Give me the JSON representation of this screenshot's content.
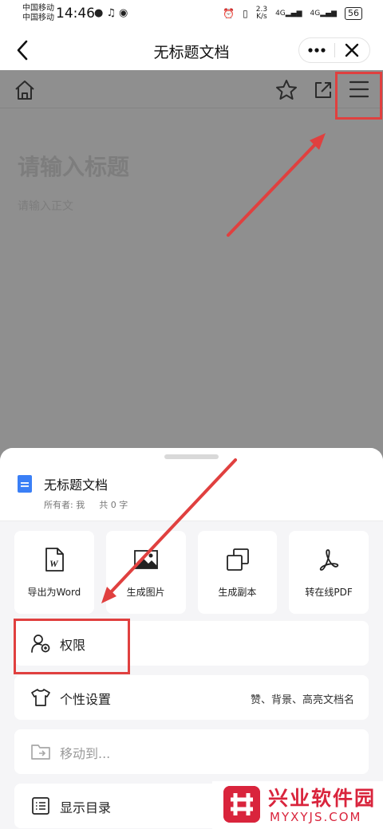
{
  "status_bar": {
    "carrier_1": "中国移动",
    "carrier_2": "中国移动",
    "time": "14:46",
    "net_speed_value": "2.3",
    "net_speed_unit": "K/s",
    "signal_1": "4G",
    "signal_2": "4G",
    "battery": "56"
  },
  "title_bar": {
    "title": "无标题文档",
    "back_icon": "chevron-left-icon",
    "more_icon": "more-dots-icon",
    "close_icon": "close-icon"
  },
  "editor": {
    "title_placeholder": "请输入标题",
    "body_placeholder": "请输入正文"
  },
  "sheet": {
    "doc_name": "无标题文档",
    "owner": "所有者: 我",
    "word_count": "共 0 字",
    "tiles": [
      {
        "label": "导出为Word",
        "icon": "word-file-icon"
      },
      {
        "label": "生成图片",
        "icon": "image-icon"
      },
      {
        "label": "生成副本",
        "icon": "copy-icon"
      },
      {
        "label": "转在线PDF",
        "icon": "pdf-icon"
      }
    ],
    "rows": [
      {
        "label": "权限",
        "hint": "",
        "icon": "user-permission-icon"
      },
      {
        "label": "个性设置",
        "hint": "赞、背景、高亮文档名",
        "icon": "tshirt-icon"
      },
      {
        "label": "移动到...",
        "hint": "",
        "icon": "folder-move-icon"
      },
      {
        "label": "显示目录",
        "hint": "",
        "icon": "list-icon"
      }
    ]
  },
  "watermark": {
    "name_cn": "兴业软件园",
    "name_en": "MYXYJS.COM"
  },
  "colors": {
    "highlight": "#e0403f",
    "doc_icon": "#3a7ff6",
    "watermark": "#d9243c"
  }
}
